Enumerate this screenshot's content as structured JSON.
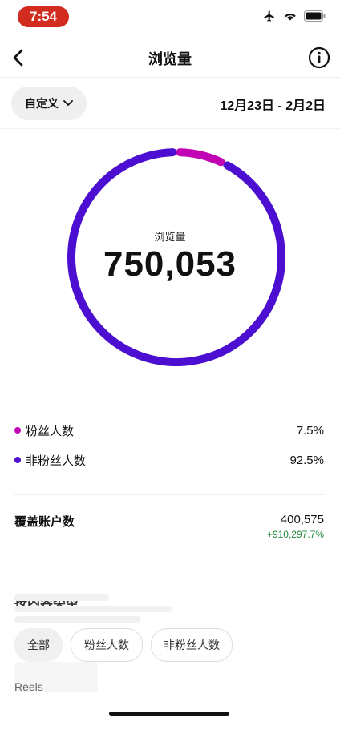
{
  "status_bar": {
    "time": "7:54",
    "icons": [
      "airplane-icon",
      "wifi-icon",
      "battery-icon"
    ]
  },
  "header": {
    "title": "浏览量"
  },
  "filter": {
    "label": "自定义",
    "date_range": "12月23日 - 2月2日"
  },
  "summary": {
    "label": "浏览量",
    "value": "750,053"
  },
  "breakdown": [
    {
      "label": "粉丝人数",
      "percent": "7.5%",
      "fraction": 0.075,
      "color": "#c200b4"
    },
    {
      "label": "非粉丝人数",
      "percent": "92.5%",
      "fraction": 0.925,
      "color": "#4c0fd1"
    }
  ],
  "reach": {
    "label": "覆盖账户数",
    "value": "400,575",
    "change": "+910,297.7%"
  },
  "content_type": {
    "title": "按内容类型",
    "tabs": [
      "全部",
      "粉丝人数",
      "非粉丝人数"
    ],
    "selected": "全部",
    "first_item": "Reels"
  }
}
